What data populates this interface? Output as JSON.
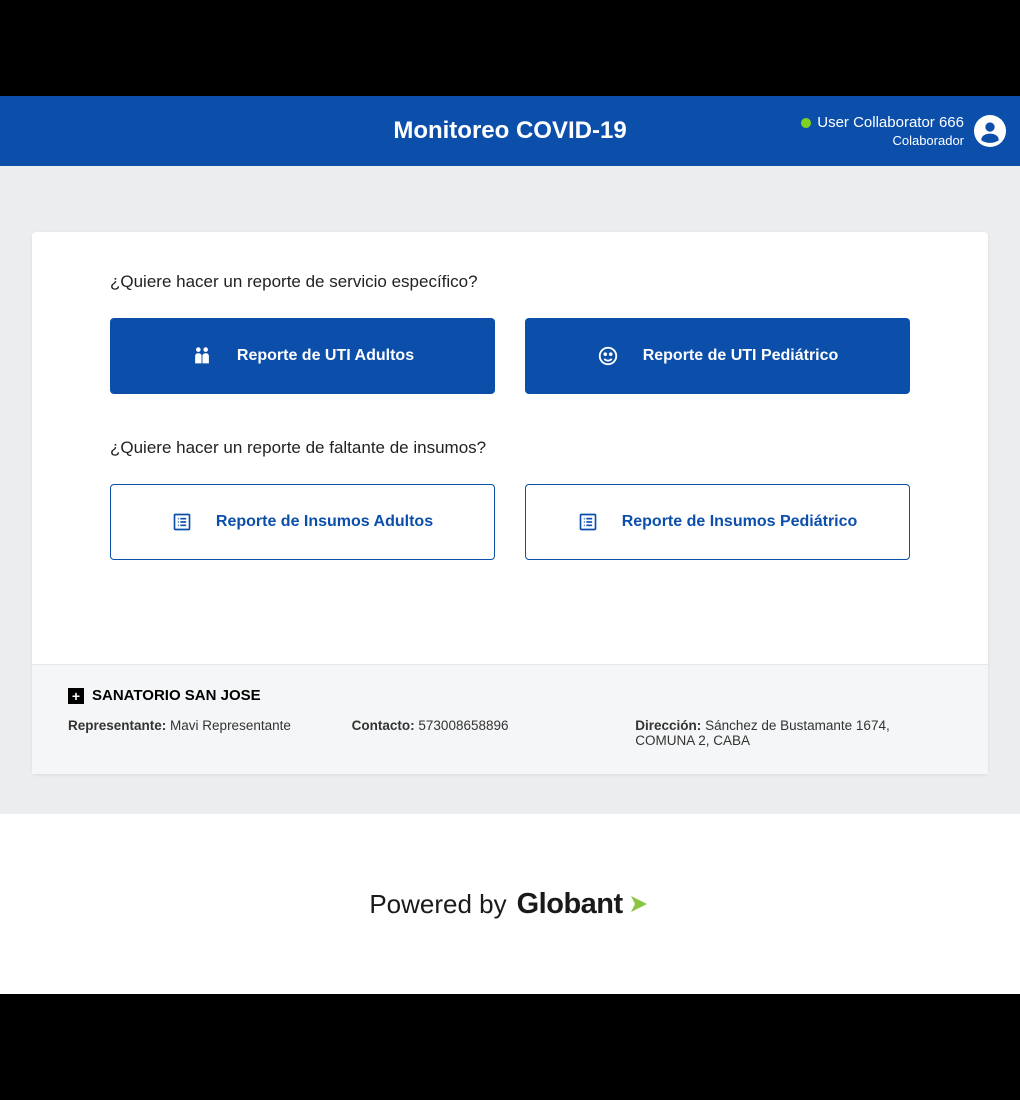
{
  "header": {
    "title": "Monitoreo COVID-19",
    "user_name": "User Collaborator 666",
    "user_role": "Colaborador"
  },
  "main": {
    "question_service": "¿Quiere hacer un reporte de servicio específico?",
    "btn_uti_adults": "Reporte de UTI Adultos",
    "btn_uti_pediatric": "Reporte de UTI Pediátrico",
    "question_supplies": "¿Quiere hacer un reporte de faltante de insumos?",
    "btn_supplies_adults": "Reporte de Insumos Adultos",
    "btn_supplies_pediatric": "Reporte de Insumos Pediátrico"
  },
  "hospital": {
    "name": "SANATORIO SAN JOSE",
    "rep_label": "Representante:",
    "rep_value": "Mavi Representante",
    "contact_label": "Contacto:",
    "contact_value": "573008658896",
    "address_label": "Dirección:",
    "address_value": "Sánchez de Bustamante 1674, COMUNA 2, CABA"
  },
  "footer": {
    "powered_by": "Powered by",
    "brand": "Globant"
  }
}
